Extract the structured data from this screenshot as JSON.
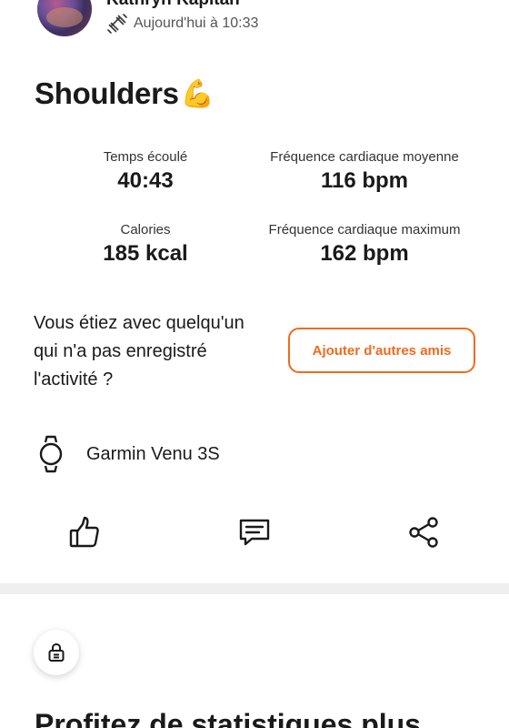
{
  "header": {
    "athlete_name": "Kathryn Kapitan",
    "activity_icon": "dumbbell-icon",
    "time": "Aujourd'hui à 10:33"
  },
  "activity": {
    "title": "Shoulders",
    "emoji": "💪"
  },
  "stats": [
    {
      "label": "Temps écoulé",
      "value": "40:43"
    },
    {
      "label": "Fréquence cardiaque moyenne",
      "value": "116 bpm"
    },
    {
      "label": "Calories",
      "value": "185 kcal"
    },
    {
      "label": "Fréquence cardiaque maximum",
      "value": "162 bpm"
    }
  ],
  "friends_prompt": {
    "text": "Vous étiez avec quelqu'un qui n'a pas enregistré l'activité ?",
    "button_label": "Ajouter d'autres amis"
  },
  "device": {
    "icon": "watch-icon",
    "name": "Garmin Venu 3S"
  },
  "actions": {
    "like_icon": "thumbs-up-icon",
    "comment_icon": "comment-icon",
    "share_icon": "share-icon"
  },
  "promo": {
    "lock_icon": "lock-icon",
    "title": "Profitez de statistiques plus"
  },
  "colors": {
    "accent": "#f26a1b",
    "divider": "#efefed",
    "text": "#1a1a1a"
  }
}
